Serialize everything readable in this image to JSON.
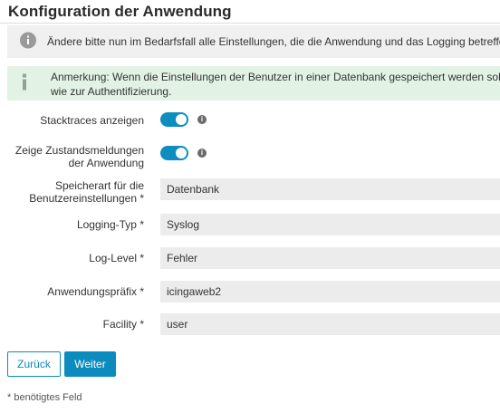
{
  "page": {
    "title": "Konfiguration der Anwendung"
  },
  "info_box": {
    "icon": "info-circle-icon",
    "text": "Ändere bitte nun im Bedarfsfall alle Einstellungen, die die Anwendung und das Logging betreffen."
  },
  "note_box": {
    "icon": "info-i-icon",
    "line1": "Anmerkung: Wenn die Einstellungen der Benutzer in einer Datenbank gespeichert werden sollen, ver",
    "line2": "wie zur Authentifizierung."
  },
  "form": {
    "stacktraces": {
      "label": "Stacktraces anzeigen",
      "enabled": true
    },
    "status_messages": {
      "label_line1": "Zeige Zustandsmeldungen",
      "label_line2": "der Anwendung",
      "enabled": true
    },
    "storage_type": {
      "label_line1": "Speicherart für die",
      "label_line2": "Benutzereinstellungen *",
      "value": "Datenbank"
    },
    "logging_type": {
      "label": "Logging-Typ *",
      "value": "Syslog"
    },
    "log_level": {
      "label": "Log-Level *",
      "value": "Fehler"
    },
    "app_prefix": {
      "label": "Anwendungspräfix *",
      "value": "icingaweb2"
    },
    "facility": {
      "label": "Facility *",
      "value": "user"
    }
  },
  "buttons": {
    "back": "Zurück",
    "next": "Weiter"
  },
  "footer": {
    "required_note": "* benötigtes Feld"
  },
  "colors": {
    "accent": "#0c8bbe",
    "info_bg": "#f0f0f0",
    "note_bg": "#e2f3e6",
    "field_bg": "#ececec"
  }
}
